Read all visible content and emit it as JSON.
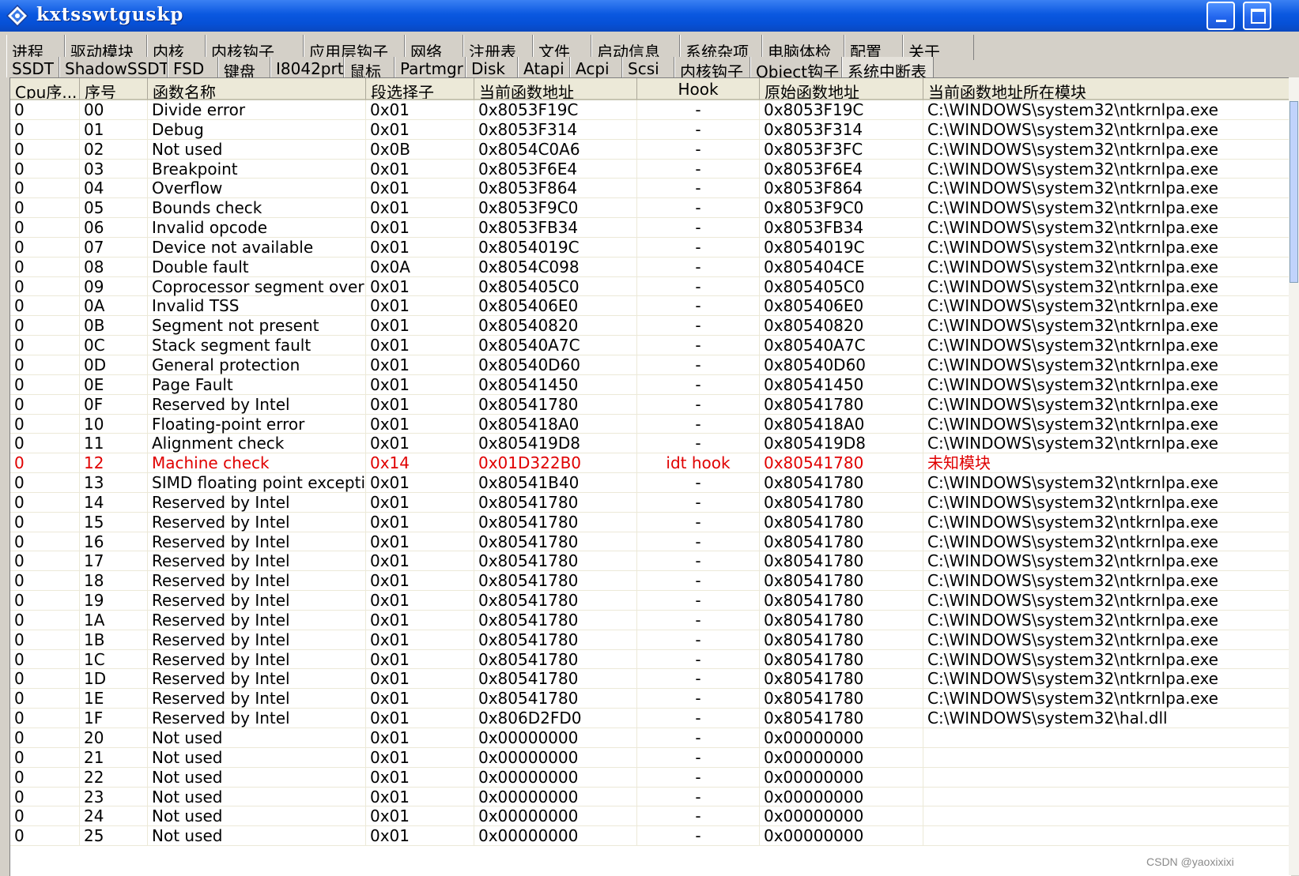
{
  "window": {
    "title": "kxtsswtguskp"
  },
  "tabs_row1": [
    "进程",
    "驱动模块",
    "内核",
    "内核钩子",
    "应用层钩子",
    "网络",
    "注册表",
    "文件",
    "启动信息",
    "系统杂项",
    "电脑体检",
    "配置",
    "关于"
  ],
  "tabs_row2": [
    "SSDT",
    "ShadowSSDT",
    "FSD",
    "键盘",
    "I8042prt",
    "鼠标",
    "Partmgr",
    "Disk",
    "Atapi",
    "Acpi",
    "Scsi",
    "内核钩子",
    "Object钩子",
    "系统中断表"
  ],
  "active_tab_row2": "系统中断表",
  "columns": [
    "Cpu序...",
    "序号",
    "函数名称",
    "段选择子",
    "当前函数地址",
    "Hook",
    "原始函数地址",
    "当前函数地址所在模块"
  ],
  "rows": [
    [
      "0",
      "00",
      "Divide error",
      "0x01",
      "0x8053F19C",
      "-",
      "0x8053F19C",
      "C:\\WINDOWS\\system32\\ntkrnlpa.exe"
    ],
    [
      "0",
      "01",
      "Debug",
      "0x01",
      "0x8053F314",
      "-",
      "0x8053F314",
      "C:\\WINDOWS\\system32\\ntkrnlpa.exe"
    ],
    [
      "0",
      "02",
      "Not used",
      "0x0B",
      "0x8054C0A6",
      "-",
      "0x8053F3FC",
      "C:\\WINDOWS\\system32\\ntkrnlpa.exe"
    ],
    [
      "0",
      "03",
      "Breakpoint",
      "0x01",
      "0x8053F6E4",
      "-",
      "0x8053F6E4",
      "C:\\WINDOWS\\system32\\ntkrnlpa.exe"
    ],
    [
      "0",
      "04",
      "Overflow",
      "0x01",
      "0x8053F864",
      "-",
      "0x8053F864",
      "C:\\WINDOWS\\system32\\ntkrnlpa.exe"
    ],
    [
      "0",
      "05",
      "Bounds check",
      "0x01",
      "0x8053F9C0",
      "-",
      "0x8053F9C0",
      "C:\\WINDOWS\\system32\\ntkrnlpa.exe"
    ],
    [
      "0",
      "06",
      "Invalid opcode",
      "0x01",
      "0x8053FB34",
      "-",
      "0x8053FB34",
      "C:\\WINDOWS\\system32\\ntkrnlpa.exe"
    ],
    [
      "0",
      "07",
      "Device not available",
      "0x01",
      "0x8054019C",
      "-",
      "0x8054019C",
      "C:\\WINDOWS\\system32\\ntkrnlpa.exe"
    ],
    [
      "0",
      "08",
      "Double fault",
      "0x0A",
      "0x8054C098",
      "-",
      "0x805404CE",
      "C:\\WINDOWS\\system32\\ntkrnlpa.exe"
    ],
    [
      "0",
      "09",
      "Coprocessor segment overr...",
      "0x01",
      "0x805405C0",
      "-",
      "0x805405C0",
      "C:\\WINDOWS\\system32\\ntkrnlpa.exe"
    ],
    [
      "0",
      "0A",
      "Invalid TSS",
      "0x01",
      "0x805406E0",
      "-",
      "0x805406E0",
      "C:\\WINDOWS\\system32\\ntkrnlpa.exe"
    ],
    [
      "0",
      "0B",
      "Segment not present",
      "0x01",
      "0x80540820",
      "-",
      "0x80540820",
      "C:\\WINDOWS\\system32\\ntkrnlpa.exe"
    ],
    [
      "0",
      "0C",
      "Stack segment fault",
      "0x01",
      "0x80540A7C",
      "-",
      "0x80540A7C",
      "C:\\WINDOWS\\system32\\ntkrnlpa.exe"
    ],
    [
      "0",
      "0D",
      "General protection",
      "0x01",
      "0x80540D60",
      "-",
      "0x80540D60",
      "C:\\WINDOWS\\system32\\ntkrnlpa.exe"
    ],
    [
      "0",
      "0E",
      "Page Fault",
      "0x01",
      "0x80541450",
      "-",
      "0x80541450",
      "C:\\WINDOWS\\system32\\ntkrnlpa.exe"
    ],
    [
      "0",
      "0F",
      "Reserved by Intel",
      "0x01",
      "0x80541780",
      "-",
      "0x80541780",
      "C:\\WINDOWS\\system32\\ntkrnlpa.exe"
    ],
    [
      "0",
      "10",
      "Floating-point error",
      "0x01",
      "0x805418A0",
      "-",
      "0x805418A0",
      "C:\\WINDOWS\\system32\\ntkrnlpa.exe"
    ],
    [
      "0",
      "11",
      "Alignment check",
      "0x01",
      "0x805419D8",
      "-",
      "0x805419D8",
      "C:\\WINDOWS\\system32\\ntkrnlpa.exe"
    ],
    [
      "0",
      "12",
      "Machine check",
      "0x14",
      "0x01D322B0",
      "idt hook",
      "0x80541780",
      "未知模块"
    ],
    [
      "0",
      "13",
      "SIMD floating point excepti...",
      "0x01",
      "0x80541B40",
      "-",
      "0x80541780",
      "C:\\WINDOWS\\system32\\ntkrnlpa.exe"
    ],
    [
      "0",
      "14",
      "Reserved by Intel",
      "0x01",
      "0x80541780",
      "-",
      "0x80541780",
      "C:\\WINDOWS\\system32\\ntkrnlpa.exe"
    ],
    [
      "0",
      "15",
      "Reserved by Intel",
      "0x01",
      "0x80541780",
      "-",
      "0x80541780",
      "C:\\WINDOWS\\system32\\ntkrnlpa.exe"
    ],
    [
      "0",
      "16",
      "Reserved by Intel",
      "0x01",
      "0x80541780",
      "-",
      "0x80541780",
      "C:\\WINDOWS\\system32\\ntkrnlpa.exe"
    ],
    [
      "0",
      "17",
      "Reserved by Intel",
      "0x01",
      "0x80541780",
      "-",
      "0x80541780",
      "C:\\WINDOWS\\system32\\ntkrnlpa.exe"
    ],
    [
      "0",
      "18",
      "Reserved by Intel",
      "0x01",
      "0x80541780",
      "-",
      "0x80541780",
      "C:\\WINDOWS\\system32\\ntkrnlpa.exe"
    ],
    [
      "0",
      "19",
      "Reserved by Intel",
      "0x01",
      "0x80541780",
      "-",
      "0x80541780",
      "C:\\WINDOWS\\system32\\ntkrnlpa.exe"
    ],
    [
      "0",
      "1A",
      "Reserved by Intel",
      "0x01",
      "0x80541780",
      "-",
      "0x80541780",
      "C:\\WINDOWS\\system32\\ntkrnlpa.exe"
    ],
    [
      "0",
      "1B",
      "Reserved by Intel",
      "0x01",
      "0x80541780",
      "-",
      "0x80541780",
      "C:\\WINDOWS\\system32\\ntkrnlpa.exe"
    ],
    [
      "0",
      "1C",
      "Reserved by Intel",
      "0x01",
      "0x80541780",
      "-",
      "0x80541780",
      "C:\\WINDOWS\\system32\\ntkrnlpa.exe"
    ],
    [
      "0",
      "1D",
      "Reserved by Intel",
      "0x01",
      "0x80541780",
      "-",
      "0x80541780",
      "C:\\WINDOWS\\system32\\ntkrnlpa.exe"
    ],
    [
      "0",
      "1E",
      "Reserved by Intel",
      "0x01",
      "0x80541780",
      "-",
      "0x80541780",
      "C:\\WINDOWS\\system32\\ntkrnlpa.exe"
    ],
    [
      "0",
      "1F",
      "Reserved by Intel",
      "0x01",
      "0x806D2FD0",
      "-",
      "0x80541780",
      "C:\\WINDOWS\\system32\\hal.dll"
    ],
    [
      "0",
      "20",
      "Not used",
      "0x01",
      "0x00000000",
      "-",
      "0x00000000",
      ""
    ],
    [
      "0",
      "21",
      "Not used",
      "0x01",
      "0x00000000",
      "-",
      "0x00000000",
      ""
    ],
    [
      "0",
      "22",
      "Not used",
      "0x01",
      "0x00000000",
      "-",
      "0x00000000",
      ""
    ],
    [
      "0",
      "23",
      "Not used",
      "0x01",
      "0x00000000",
      "-",
      "0x00000000",
      ""
    ],
    [
      "0",
      "24",
      "Not used",
      "0x01",
      "0x00000000",
      "-",
      "0x00000000",
      ""
    ],
    [
      "0",
      "25",
      "Not used",
      "0x01",
      "0x00000000",
      "-",
      "0x00000000",
      ""
    ]
  ],
  "hooked_row_index": 18,
  "colors": {
    "hook_text": "#e00000",
    "titlebar": "#0a58e0"
  },
  "icons": {
    "app": "app-diamond-icon",
    "minimize": "minimize-icon",
    "maximize": "maximize-icon"
  },
  "watermark": "CSDN @yaoxixixi"
}
